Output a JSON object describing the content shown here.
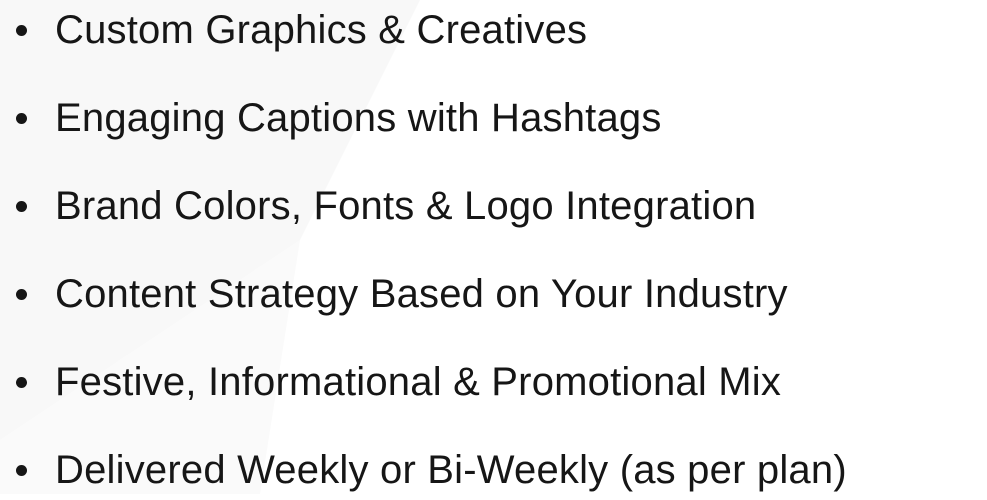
{
  "features": {
    "items": [
      {
        "text": "Custom Graphics & Creatives"
      },
      {
        "text": "Engaging Captions with Hashtags"
      },
      {
        "text": "Brand Colors, Fonts & Logo Integration"
      },
      {
        "text": "Content Strategy Based on Your Industry"
      },
      {
        "text": "Festive, Informational & Promotional Mix"
      },
      {
        "text": "Delivered Weekly or Bi-Weekly (as per plan)"
      }
    ]
  },
  "colors": {
    "text": "#161616",
    "background": "#ffffff",
    "watermark": "#f6f6f6"
  }
}
